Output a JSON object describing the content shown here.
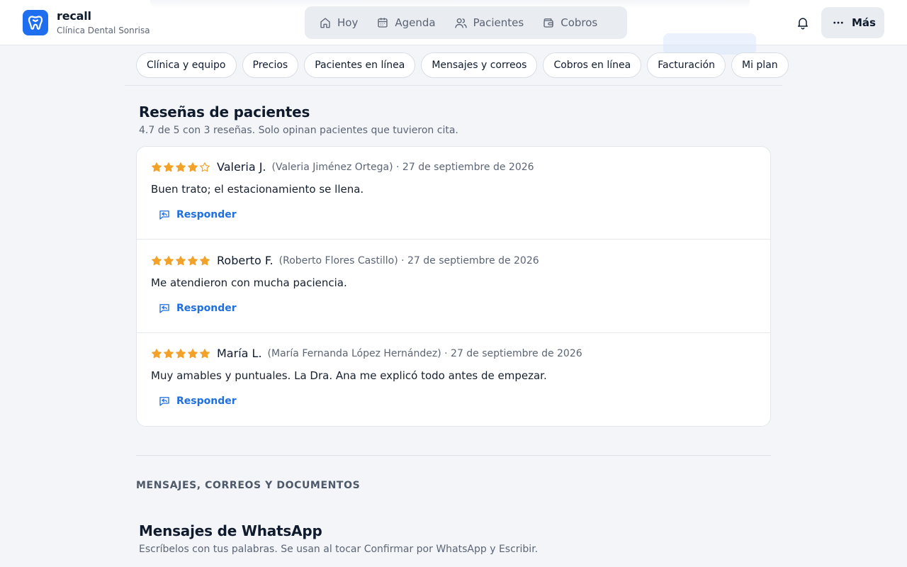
{
  "brand": {
    "name": "recall",
    "subtitle": "Clínica Dental Sonrisa",
    "color": "#1e6ff0"
  },
  "nav": {
    "items": [
      {
        "label": "Hoy",
        "icon": "home-icon"
      },
      {
        "label": "Agenda",
        "icon": "calendar-icon"
      },
      {
        "label": "Pacientes",
        "icon": "users-icon"
      },
      {
        "label": "Cobros",
        "icon": "wallet-icon"
      }
    ],
    "more_label": "Más",
    "notifications_icon": "bell-icon"
  },
  "tabs": [
    "Clínica y equipo",
    "Precios",
    "Pacientes en línea",
    "Mensajes y correos",
    "Cobros en línea",
    "Facturación",
    "Mi plan"
  ],
  "reviews_section": {
    "title": "Reseñas de pacientes",
    "subtitle": "4.7 de 5 con 3 reseñas. Solo opinan pacientes que tuvieron cita.",
    "reply_label": "Responder",
    "star_color": "#f2a229",
    "items": [
      {
        "rating": 4,
        "name": "Valeria J.",
        "meta": "(Valeria Jiménez Ortega) · 27 de septiembre de 2026",
        "text": "Buen trato; el estacionamiento se llena."
      },
      {
        "rating": 5,
        "name": "Roberto F.",
        "meta": "(Roberto Flores Castillo) · 27 de septiembre de 2026",
        "text": "Me atendieron con mucha paciencia."
      },
      {
        "rating": 5,
        "name": "María L.",
        "meta": "(María Fernanda López Hernández) · 27 de septiembre de 2026",
        "text": "Muy amables y puntuales. La Dra. Ana me explicó todo antes de empezar."
      }
    ]
  },
  "messages_section": {
    "heading": "MENSAJES, CORREOS Y DOCUMENTOS",
    "title": "Mensajes de WhatsApp",
    "subtitle": "Escríbelos con tus palabras. Se usan al tocar Confirmar por WhatsApp y Escribir."
  }
}
